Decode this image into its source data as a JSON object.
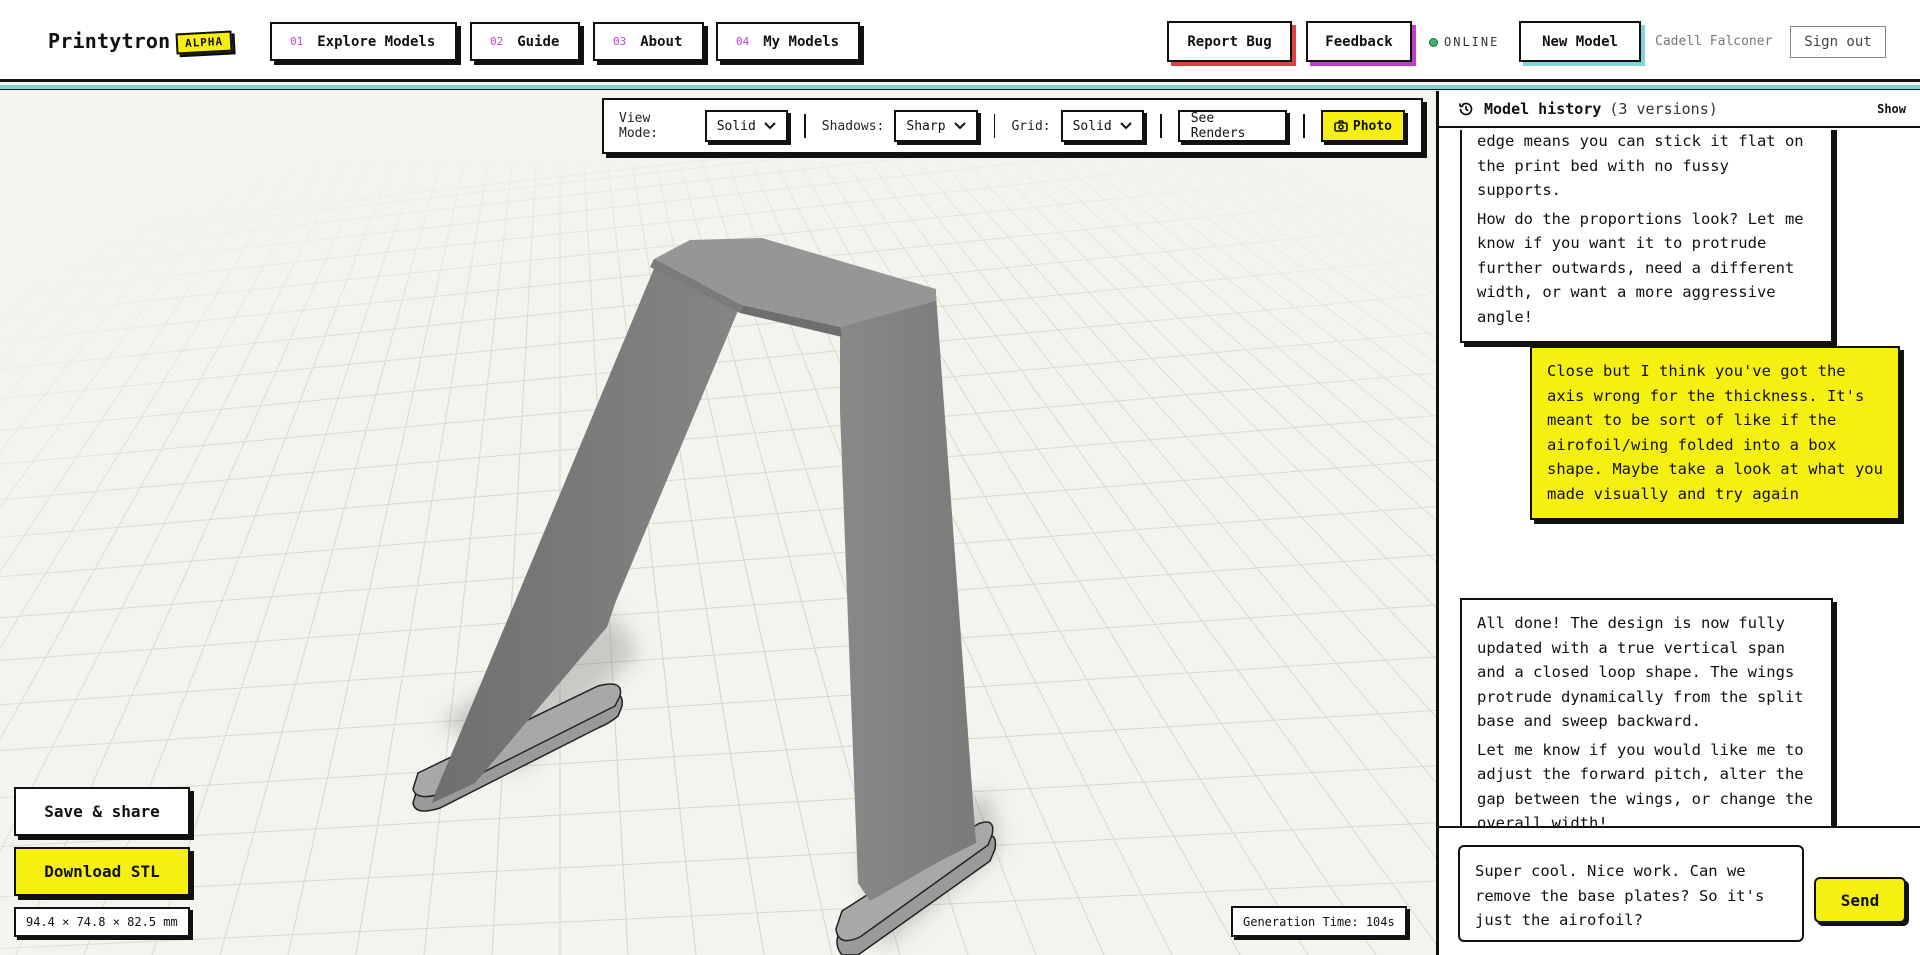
{
  "header": {
    "brand": "Printytron",
    "badge": "ALPHA",
    "nav": [
      {
        "num": "01",
        "label": "Explore Models"
      },
      {
        "num": "02",
        "label": "Guide"
      },
      {
        "num": "03",
        "label": "About"
      },
      {
        "num": "04",
        "label": "My Models"
      }
    ],
    "report_bug": "Report Bug",
    "feedback": "Feedback",
    "status": "ONLINE",
    "new_model": "New Model",
    "user_name": "Cadell Falconer",
    "sign_out": "Sign out"
  },
  "toolbar": {
    "view_mode_label": "View Mode:",
    "view_mode_value": "Solid",
    "shadows_label": "Shadows:",
    "shadows_value": "Sharp",
    "grid_label": "Grid:",
    "grid_value": "Solid",
    "see_renders": "See Renders",
    "photo": "Photo"
  },
  "viewport": {
    "save_share": "Save & share",
    "download_stl": "Download STL",
    "dimensions": "94.4 × 74.8 × 82.5 mm",
    "generation_time": "Generation Time: 104s"
  },
  "history": {
    "title": "Model history",
    "count": "(3 versions)",
    "toggle": "Show"
  },
  "messages": [
    {
      "role": "assistant",
      "paragraphs": [
        "edge means you can stick it flat on the print bed with no fussy supports.",
        "How do the proportions look? Let me know if you want it to protrude further outwards, need a different width, or want a more aggressive angle!"
      ]
    },
    {
      "role": "user",
      "paragraphs": [
        "Close but I think you've got the axis wrong for the thickness. It's meant to be sort of like if the airofoil/wing folded into a box shape. Maybe take a look at what you made visually and try again"
      ]
    },
    {
      "role": "assistant",
      "paragraphs": [
        "All done! The design is now fully updated with a true vertical span and a closed loop shape. The wings protrude dynamically from the split base and sweep backward.",
        "Let me know if you would like me to adjust the forward pitch, alter the gap between the wings, or change the overall width!"
      ]
    }
  ],
  "composer": {
    "value": "Super cool. Nice work. Can we remove the base plates? So it's just the airofoil?",
    "send": "Send"
  },
  "colors": {
    "accent_yellow": "#f5f012",
    "accent_teal": "#7fd6d8",
    "accent_magenta": "#c13dd0",
    "accent_red": "#e04040",
    "online_green": "#3cb371",
    "model_gray": "#7d7d7d"
  }
}
